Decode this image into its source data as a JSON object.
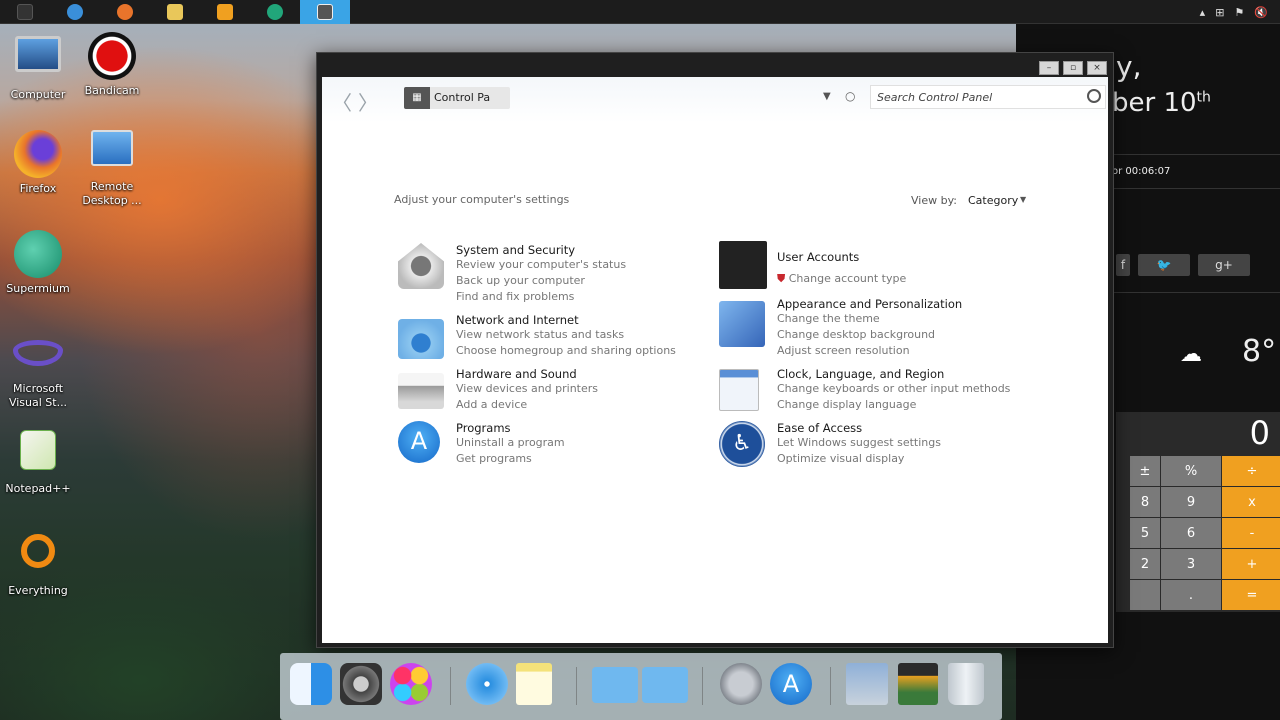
{
  "taskbar": {
    "apps": [
      {
        "name": "start-icon",
        "color": "#333333"
      },
      {
        "name": "internet-explorer-icon",
        "color": "#3a8fd9"
      },
      {
        "name": "firefox-icon",
        "color": "#e8742b"
      },
      {
        "name": "file-explorer-icon",
        "color": "#e9c75a"
      },
      {
        "name": "media-player-icon",
        "color": "#f0a020"
      },
      {
        "name": "supermium-icon",
        "color": "#21a67a"
      },
      {
        "name": "control-panel-icon",
        "color": "#555555"
      }
    ],
    "tray_icons": [
      "chevron-up-icon",
      "network-icon",
      "flag-icon",
      "volume-icon"
    ]
  },
  "desktop_icons": [
    {
      "label": "Computer",
      "icon": "monitor-icon",
      "color": "#3d6fa8"
    },
    {
      "label": "Bandicam",
      "icon": "record-icon",
      "color": "#dd1111"
    },
    {
      "label": "Firefox",
      "icon": "firefox-icon",
      "color": "#e8742b"
    },
    {
      "label": "Remote Desktop ...",
      "icon": "remote-desktop-icon",
      "color": "#2f7fd0"
    },
    {
      "label": "Supermium",
      "icon": "supermium-icon",
      "color": "#1fa27a"
    },
    {
      "label": "Microsoft Visual St...",
      "icon": "visual-studio-icon",
      "color": "#6a4fc8"
    },
    {
      "label": "Notepad++",
      "icon": "notepadpp-icon",
      "color": "#6ab04c"
    },
    {
      "label": "Everything",
      "icon": "search-magnifier-icon",
      "color": "#f08a12"
    }
  ],
  "gadgets": {
    "date_line1": "y,",
    "date_line2": "ber 10",
    "date_sup": "th",
    "timer": "or 00:06:07",
    "social": [
      "f",
      "🐦",
      "g+"
    ],
    "temperature": "8°",
    "calculator": {
      "display": "0",
      "keys": [
        [
          "±",
          "%",
          "÷"
        ],
        [
          "8",
          "9",
          "x"
        ],
        [
          "5",
          "6",
          "-"
        ],
        [
          "2",
          "3",
          "+"
        ],
        [
          "",
          ".",
          "="
        ]
      ]
    }
  },
  "window": {
    "controls": [
      "–",
      "▫",
      "×"
    ],
    "breadcrumb": "Control Panel",
    "search_placeholder": "Search Control Panel",
    "subtitle": "Adjust your computer's settings",
    "view_by_label": "View by:",
    "view_by_value": "Category",
    "categories": [
      {
        "title": "System and Security",
        "icon": "system-security-icon",
        "links": [
          "Review your computer's status",
          "Back up your computer",
          "Find and fix problems"
        ]
      },
      {
        "title": "Network and Internet",
        "icon": "network-folder-icon",
        "links": [
          "View network status and tasks",
          "Choose homegroup and sharing options"
        ]
      },
      {
        "title": "Hardware and Sound",
        "icon": "printer-icon",
        "links": [
          "View devices and printers",
          "Add a device"
        ]
      },
      {
        "title": "Programs",
        "icon": "app-store-icon",
        "links": [
          "Uninstall a program",
          "Get programs"
        ]
      },
      {
        "title": "User Accounts",
        "icon": "users-icon",
        "links": [
          "Change account type"
        ]
      },
      {
        "title": "Appearance and Personalization",
        "icon": "personalization-icon",
        "links": [
          "Change the theme",
          "Change desktop background",
          "Adjust screen resolution"
        ]
      },
      {
        "title": "Clock, Language, and Region",
        "icon": "calendar-clock-icon",
        "links": [
          "Change keyboards or other input methods",
          "Change display language"
        ]
      },
      {
        "title": "Ease of Access",
        "icon": "accessibility-icon",
        "links": [
          "Let Windows suggest settings",
          "Optimize visual display"
        ]
      }
    ]
  },
  "dock": [
    {
      "name": "finder-icon",
      "color": "#2d8fe6"
    },
    {
      "name": "system-preferences-icon",
      "color": "#555555"
    },
    {
      "name": "game-center-icon",
      "color": "#d64fb0"
    },
    {
      "name": "safari-icon",
      "color": "#2a8fe0"
    },
    {
      "name": "notes-icon",
      "color": "#f4e27a"
    },
    {
      "name": "folder-icon",
      "color": "#6fb8ef"
    },
    {
      "name": "applications-folder-icon",
      "color": "#6fb8ef"
    },
    {
      "name": "launchpad-icon",
      "color": "#8a8f96"
    },
    {
      "name": "app-store-icon",
      "color": "#1e84e4"
    },
    {
      "name": "preview-icon",
      "color": "#9aa6b2"
    },
    {
      "name": "photo-booth-icon",
      "color": "#2b2b2b"
    },
    {
      "name": "trash-icon",
      "color": "#cfd6dc"
    }
  ]
}
